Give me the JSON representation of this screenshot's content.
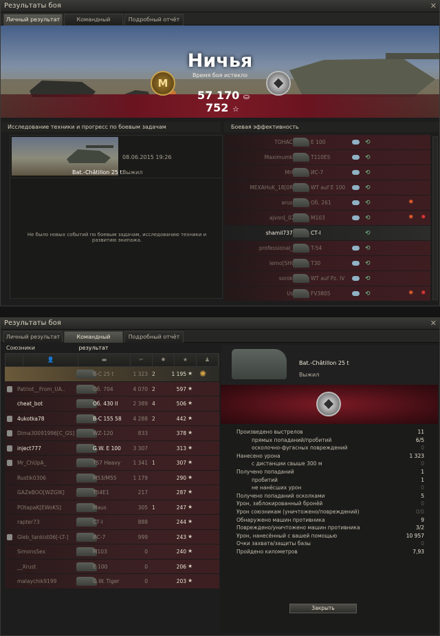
{
  "window1": {
    "title": "Результаты боя",
    "tabs": [
      "Личный результат",
      "Командный результат",
      "Подробный отчёт"
    ]
  },
  "hero": {
    "result": "Ничья",
    "subtitle": "Время боя истекло",
    "credits": "57 170",
    "xp": "752",
    "medal_letter": "M"
  },
  "left_section_title": "Исследование техники и прогресс по боевым задачам",
  "vehicle": {
    "name": "Bat.-Châtillon 25 t",
    "date": "08.06.2015 19:26",
    "status": "Выжил"
  },
  "no_events": "Не было новых событий по боевым задачам, исследованию техники и развитию экипажа.",
  "right_section_title": "Боевая эффективность",
  "efficiency": [
    {
      "player": "TOHAC004",
      "tank": "E 100",
      "spot": true,
      "dmg": true,
      "hit": false,
      "kill": false
    },
    {
      "player": "Maximumkrovi",
      "tank": "T110E5",
      "spot": true,
      "dmg": true,
      "hit": false,
      "kill": false
    },
    {
      "player": "Mrkom",
      "tank": "ИС-7",
      "spot": true,
      "dmg": true,
      "hit": false,
      "kill": false
    },
    {
      "player": "MEXAHuK_18[0RDA]",
      "tank": "WT auf E 100",
      "spot": true,
      "dmg": true,
      "hit": false,
      "kill": false
    },
    {
      "player": "arus176",
      "tank": "Об. 261",
      "spot": true,
      "dmg": true,
      "hit": true,
      "kill": false
    },
    {
      "player": "ajvon[_026_]",
      "tank": "M103",
      "spot": true,
      "dmg": true,
      "hit": true,
      "kill": true
    },
    {
      "player": "shamil737737",
      "tank": "СТ-I",
      "spot": false,
      "dmg": true,
      "hit": false,
      "kill": false,
      "me": true
    },
    {
      "player": "professional_ada",
      "tank": "T-54",
      "spot": true,
      "dmg": true,
      "hit": false,
      "kill": false
    },
    {
      "player": "iemo[SHOW]",
      "tank": "T30",
      "spot": true,
      "dmg": true,
      "hit": false,
      "kill": false
    },
    {
      "player": "soroka28",
      "tank": "WT auf Pz. IV",
      "spot": true,
      "dmg": true,
      "hit": false,
      "kill": false
    },
    {
      "player": "Ushlly",
      "tank": "FV3805",
      "spot": true,
      "dmg": true,
      "hit": true,
      "kill": true
    }
  ],
  "window2": {
    "title": "Результаты боя",
    "tabs": [
      "Личный результат",
      "Командный результат",
      "Подробный отчёт"
    ]
  },
  "team": {
    "title": "Союзники",
    "rows": [
      {
        "name": "",
        "tank": "В-С 25 t",
        "dmg": "1 323",
        "kills": "2",
        "xp": "1 195",
        "me": true,
        "platoon": false
      },
      {
        "name": "Patriot__From_UA..",
        "tank": "Об. 704",
        "dmg": "4 070",
        "kills": "2",
        "xp": "597",
        "platoon": true
      },
      {
        "name": "cheat_bot",
        "tank": "Об. 430 II",
        "dmg": "2 389",
        "kills": "4",
        "xp": "506",
        "bright": true
      },
      {
        "name": "4ukotka78",
        "tank": "В-С 155 58",
        "dmg": "4 288",
        "kills": "2",
        "xp": "442",
        "bright": true,
        "platoon": true
      },
      {
        "name": "Dima30091996[C_GS]",
        "tank": "WZ-120",
        "dmg": "833",
        "kills": "",
        "xp": "378",
        "platoon": true
      },
      {
        "name": "inject777",
        "tank": "G.W. E 100",
        "dmg": "3 307",
        "kills": "",
        "xp": "313",
        "bright": true,
        "platoon": true
      },
      {
        "name": "Mr_ChUpA_",
        "tank": "T57 Heavy",
        "dmg": "1 341",
        "kills": "1",
        "xp": "307",
        "platoon": true
      },
      {
        "name": "Rustik0306",
        "tank": "M53/M55",
        "dmg": "1 179",
        "kills": "",
        "xp": "290"
      },
      {
        "name": "GAZeBOO[WZGIK]",
        "tank": "T54E1",
        "dmg": "217",
        "kills": "",
        "xp": "287"
      },
      {
        "name": "POtapaK[EWoKS]",
        "tank": "Maus",
        "dmg": "305",
        "kills": "1",
        "xp": "247"
      },
      {
        "name": "rapter73",
        "tank": "СТ-I",
        "dmg": "888",
        "kills": "",
        "xp": "244"
      },
      {
        "name": "Gleb_tankist06[-LT-]",
        "tank": "ИС-7",
        "dmg": "999",
        "kills": "",
        "xp": "243",
        "platoon": true
      },
      {
        "name": "SimonsSex",
        "tank": "M103",
        "dmg": "0",
        "kills": "",
        "xp": "240"
      },
      {
        "name": "__Xrust",
        "tank": "E 100",
        "dmg": "0",
        "kills": "",
        "xp": "206"
      },
      {
        "name": "malaychik9199",
        "tank": "G.W. Tiger",
        "dmg": "0",
        "kills": "",
        "xp": "203"
      }
    ]
  },
  "detail": {
    "tank": "Bat.-Châtillon 25 t",
    "status": "Выжил",
    "button": "Закрыть",
    "stats": [
      {
        "label": "Произведено выстрелов",
        "value": "11"
      },
      {
        "label": "прямых попаданий/пробитий",
        "value": "6/5",
        "sub": true
      },
      {
        "label": "осколочно-фугасных повреждений",
        "value": "0",
        "sub": true,
        "dim": true
      },
      {
        "label": "Нанесено урона",
        "value": "1 323"
      },
      {
        "label": "с дистанции свыше 300 м",
        "value": "0",
        "sub": true,
        "dim": true
      },
      {
        "label": "Получено попаданий",
        "value": "1"
      },
      {
        "label": "пробитий",
        "value": "1",
        "sub": true
      },
      {
        "label": "не нанёсших урон",
        "value": "0",
        "sub": true,
        "dim": true
      },
      {
        "label": "Получено попаданий осколками",
        "value": "5"
      },
      {
        "label": "Урон, заблокированный бронёй",
        "value": "0",
        "dim": true
      },
      {
        "label": "Урон союзникам (уничтожено/повреждений)",
        "value": "0/0",
        "dim": true
      },
      {
        "label": "Обнаружено машин противника",
        "value": "9"
      },
      {
        "label": "Повреждено/уничтожено машин противника",
        "value": "3/2"
      },
      {
        "label": "Урон, нанесённый с вашей помощью",
        "value": "10 957"
      },
      {
        "label": "Очки захвата/защиты базы",
        "value": "0",
        "dim": true
      },
      {
        "label": "Пройдено километров",
        "value": "7,93"
      }
    ]
  },
  "colors": {
    "accent": "#7b1a26",
    "gold": "#c9a24b",
    "friendly": "#77c28f",
    "hit": "#dd5a2b"
  }
}
